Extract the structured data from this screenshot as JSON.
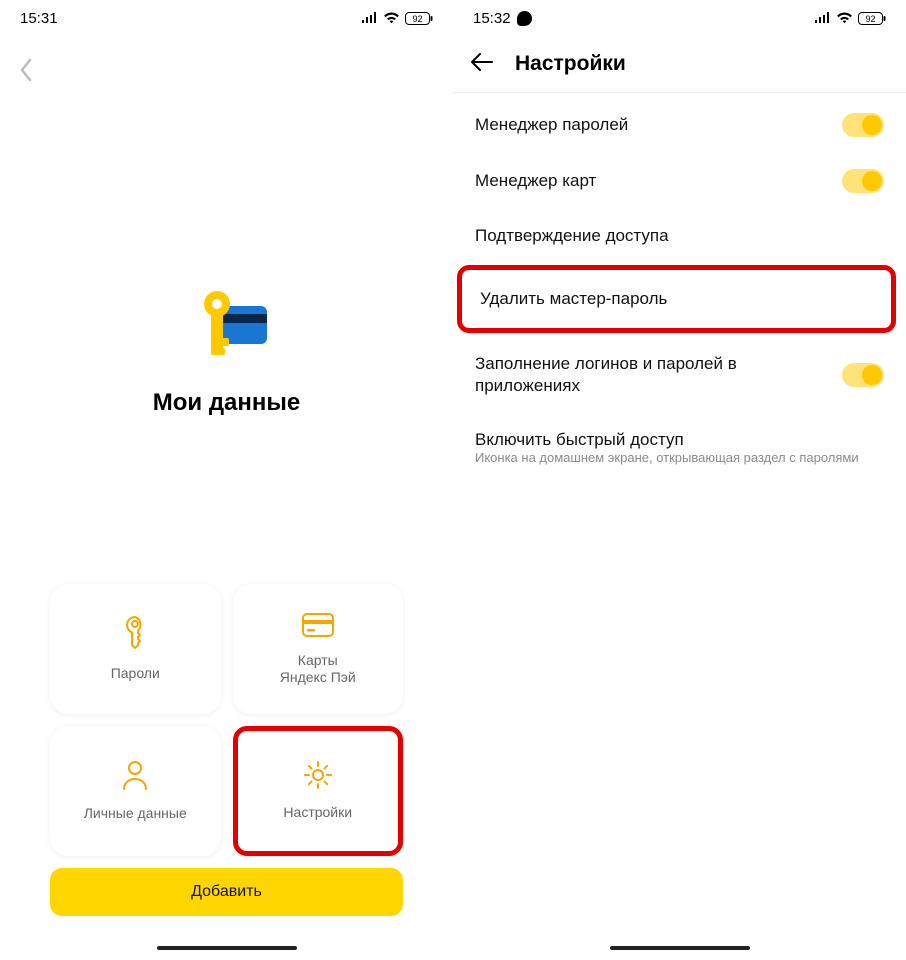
{
  "screen1": {
    "status": {
      "time": "15:31",
      "battery": "92"
    },
    "hero_title": "Мои данные",
    "cards": {
      "passwords": "Пароли",
      "cards": "Карты\nЯндекс Пэй",
      "personal": "Личные данные",
      "settings": "Настройки"
    },
    "add_button": "Добавить"
  },
  "screen2": {
    "status": {
      "time": "15:32",
      "battery": "92"
    },
    "header_title": "Настройки",
    "rows": {
      "pw_manager": "Менеджер паролей",
      "card_manager": "Менеджер карт",
      "confirm_access": "Подтверждение доступа",
      "delete_master": "Удалить мастер-пароль",
      "autofill": "Заполнение логинов и паролей в приложениях",
      "quick_access": "Включить быстрый доступ",
      "quick_access_sub": "Иконка на домашнем экране, открывающая раздел с паролями"
    }
  }
}
